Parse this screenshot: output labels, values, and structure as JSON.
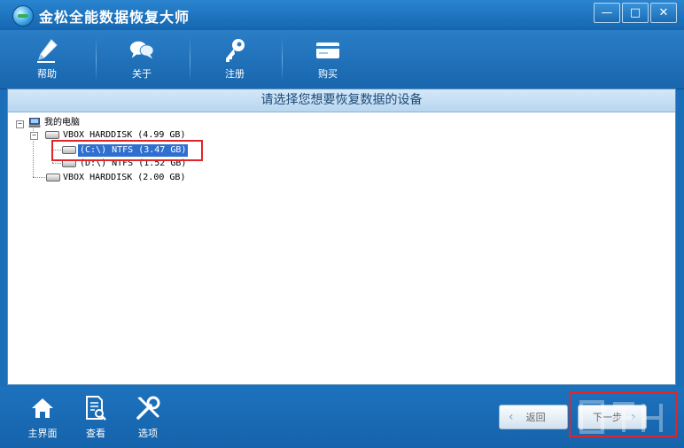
{
  "window": {
    "title": "金松全能数据恢复大师",
    "controls": {
      "minimize": "—",
      "maximize": "□",
      "close": "✕"
    }
  },
  "toolbar": {
    "items": [
      {
        "label": "帮助",
        "icon": "pen-icon"
      },
      {
        "label": "关于",
        "icon": "chat-bubbles-icon"
      },
      {
        "label": "注册",
        "icon": "key-icon"
      },
      {
        "label": "购买",
        "icon": "card-icon"
      }
    ]
  },
  "main": {
    "banner": "请选择您想要恢复数据的设备",
    "tree": {
      "root": "我的电脑",
      "disk1": "VBOX HARDDISK (4.99 GB)",
      "disk1_part1": "(C:\\) NTFS (3.47 GB)",
      "disk1_part2": "(D:\\) NTFS (1.52 GB)",
      "disk2": "VBOX HARDDISK (2.00 GB)",
      "expanded_sign": "−"
    },
    "selected_item": "(C:\\) NTFS (3.47 GB)"
  },
  "bottombar": {
    "items": [
      {
        "label": "主界面",
        "icon": "home-icon"
      },
      {
        "label": "查看",
        "icon": "document-search-icon"
      },
      {
        "label": "选项",
        "icon": "tools-icon"
      }
    ],
    "back_button": "返回",
    "next_button": "下一步",
    "back_chevron": "‹",
    "next_chevron": "›"
  },
  "colors": {
    "titlebar": "#1b6fb8",
    "selection": "#2f6fd0",
    "annotation_red": "#e0242a"
  }
}
